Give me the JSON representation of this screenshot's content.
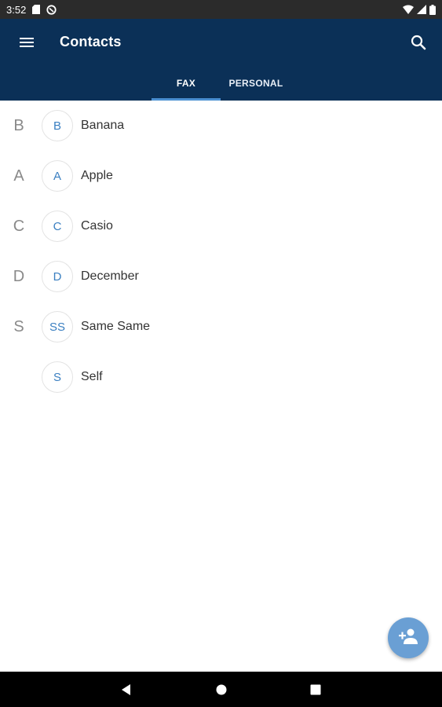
{
  "status_bar": {
    "time": "3:52",
    "icons": [
      "sd-card-icon",
      "sync-icon",
      "wifi-icon",
      "signal-icon",
      "battery-icon"
    ]
  },
  "app_bar": {
    "title": "Contacts",
    "menu_icon": "menu-icon",
    "search_icon": "search-icon",
    "background_color": "#0b3057"
  },
  "tabs": [
    {
      "label": "FAX",
      "selected": true
    },
    {
      "label": "PERSONAL",
      "selected": false
    }
  ],
  "contacts": [
    {
      "section": "B",
      "initials": "B",
      "name": "Banana"
    },
    {
      "section": "A",
      "initials": "A",
      "name": "Apple"
    },
    {
      "section": "C",
      "initials": "C",
      "name": "Casio"
    },
    {
      "section": "D",
      "initials": "D",
      "name": "December"
    },
    {
      "section": "S",
      "initials": "SS",
      "name": "Same Same"
    },
    {
      "section": "",
      "initials": "S",
      "name": "Self"
    }
  ],
  "fab": {
    "icon": "add-person-icon",
    "color": "#6a9fd4"
  },
  "nav_bar": {
    "icons": [
      "back-icon",
      "home-icon",
      "recents-icon"
    ]
  }
}
